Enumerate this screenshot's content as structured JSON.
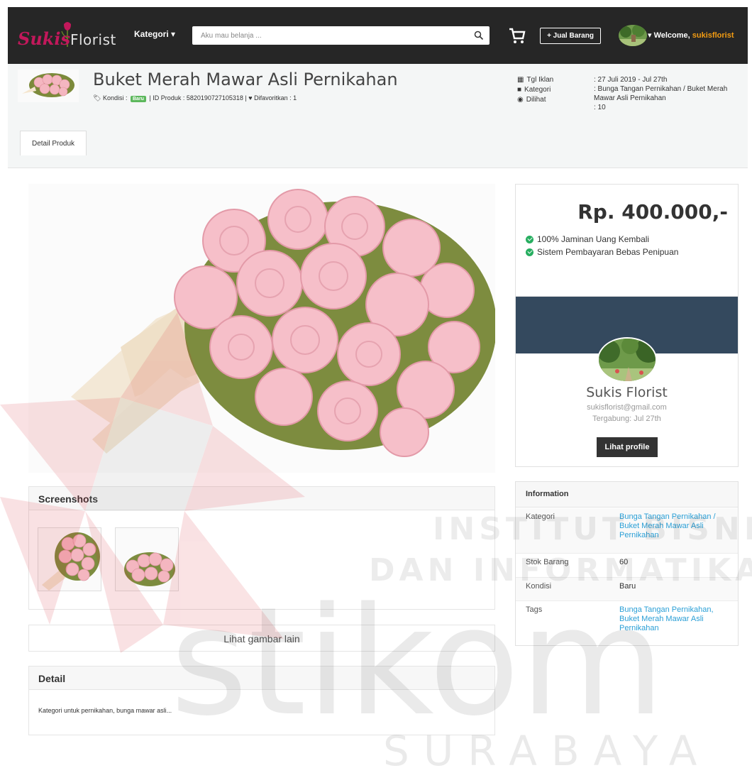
{
  "navbar": {
    "logo_script": "Sukis",
    "logo_plain": "Florist",
    "kategori_label": "Kategori",
    "search_placeholder": "Aku mau belanja ...",
    "jual_label": "+ Jual Barang",
    "welcome_prefix": "Welcome,",
    "username": "sukisflorist"
  },
  "product": {
    "title": "Buket Merah Mawar Asli Pernikahan",
    "kondisi_label": "Kondisi :",
    "kondisi_badge": "Baru",
    "id_label": "| ID Produk : 5820190727105318 |",
    "favorit_label": "Difavoritkan : 1",
    "meta": {
      "tgl_label": "Tgl Iklan",
      "kategori_label": "Kategori",
      "dilihat_label": "Dilihat",
      "tgl_value": ": 27 Juli 2019 - Jul 27th",
      "kategori_value": ": Bunga Tangan Pernikahan / Buket Merah Mawar Asli Pernikahan",
      "dilihat_value": ": 10"
    },
    "tab_label": "Detail Produk"
  },
  "gallery": {
    "screenshots_title": "Screenshots",
    "lihat_lain": "Lihat gambar lain",
    "detail_title": "Detail",
    "detail_text": "Kategori untuk pernikahan, bunga mawar asli..."
  },
  "price_box": {
    "price": "Rp. 400.000,-",
    "guarantee_1": "100% Jaminan Uang Kembali",
    "guarantee_2": "Sistem Pembayaran Bebas Penipuan"
  },
  "seller": {
    "name": "Sukis Florist",
    "email": "sukisflorist@gmail.com",
    "joined": "Tergabung: Jul 27th",
    "button": "Lihat profile"
  },
  "information": {
    "title": "Information",
    "rows": [
      {
        "key": "Kategori",
        "value": "Bunga Tangan Pernikahan / Buket Merah Mawar Asli Pernikahan"
      },
      {
        "key": "Stok Barang",
        "value": "60"
      },
      {
        "key": "Kondisi",
        "value": "Baru"
      },
      {
        "key": "Tags",
        "value": "Bunga Tangan Pernikahan, Buket Merah Mawar Asli Pernikahan"
      }
    ]
  },
  "watermark": {
    "line1": "INSTITUT BISNIS",
    "line2": "DAN INFORMATIKA",
    "big": "stikom",
    "city": "SURABAYA"
  },
  "colors": {
    "navbar": "#262626",
    "accent_user": "#f39c12",
    "badge": "#5cb85c",
    "seller_cover": "#34495e",
    "link": "#2a9fd6",
    "watermark_red": "#d9232d"
  }
}
